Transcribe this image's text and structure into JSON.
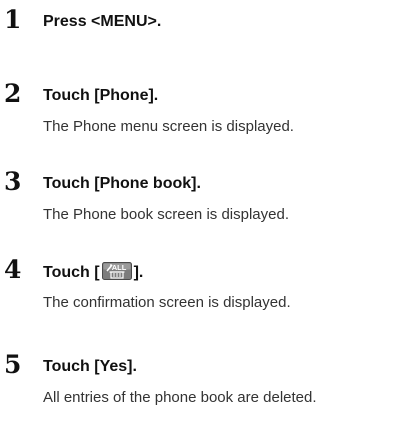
{
  "steps": [
    {
      "number": "1",
      "title": "Press <MENU>.",
      "description": ""
    },
    {
      "number": "2",
      "title": "Touch [Phone].",
      "description": "The Phone menu screen is displayed."
    },
    {
      "number": "3",
      "title": "Touch [Phone book].",
      "description": "The Phone book screen is displayed."
    },
    {
      "number": "4",
      "title_prefix": "Touch [",
      "title_icon": "delete-all-icon",
      "title_icon_text": "ALL",
      "title_suffix": "].",
      "description": "The confirmation screen is displayed."
    },
    {
      "number": "5",
      "title": "Touch [Yes].",
      "description": "All entries of the phone book are deleted."
    }
  ]
}
